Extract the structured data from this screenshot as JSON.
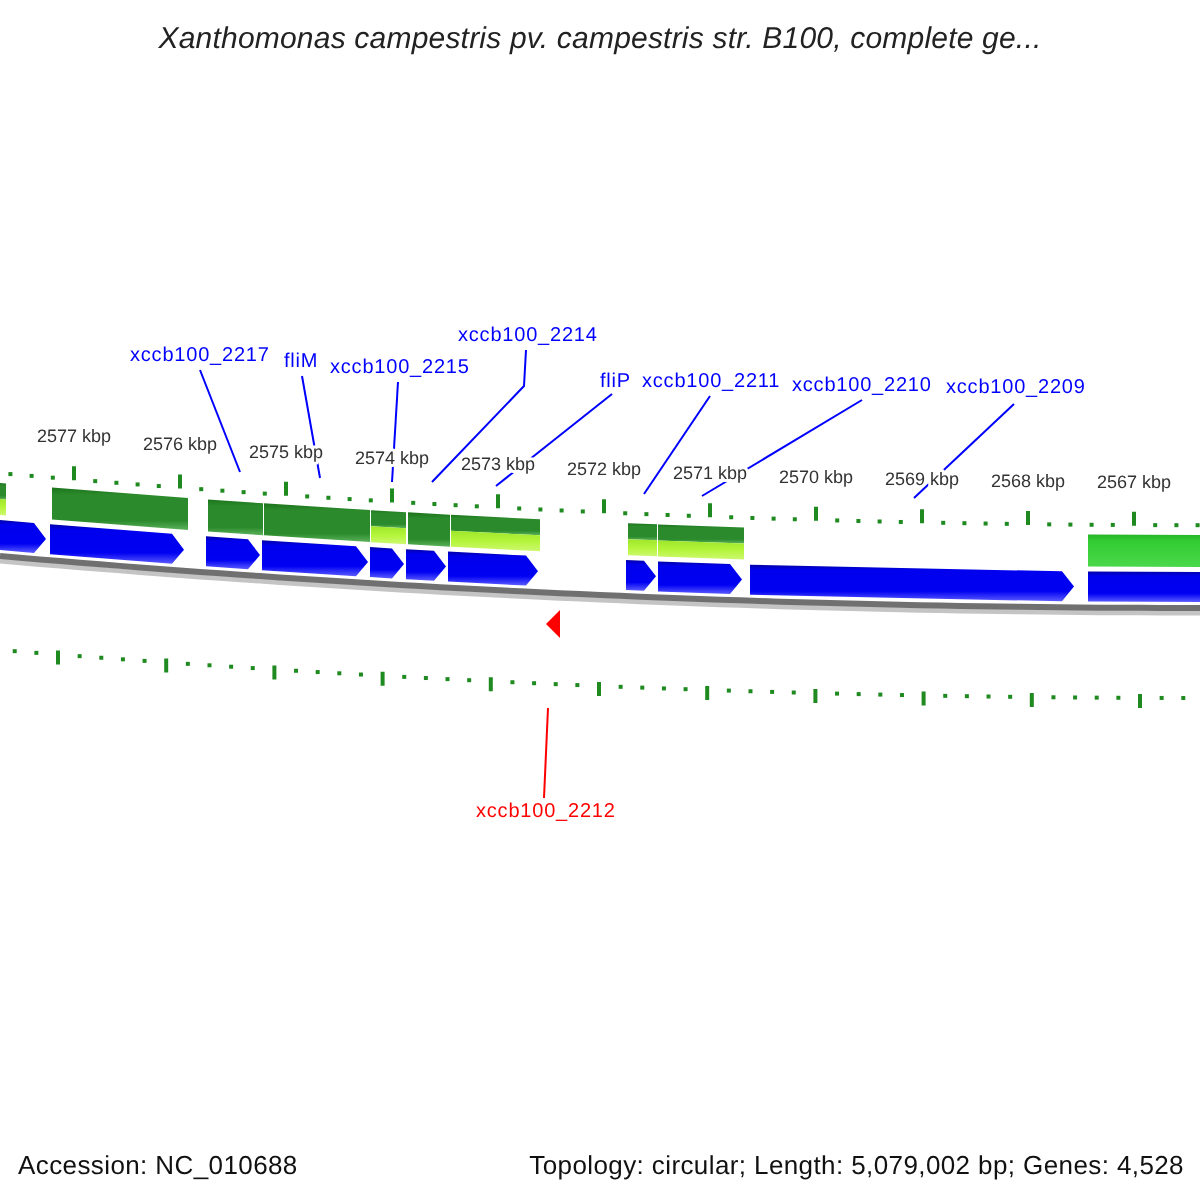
{
  "title": "Xanthomonas campestris pv. campestris str. B100, complete ge...",
  "map": {
    "ruler_labels": [
      "2577 kbp",
      "2576 kbp",
      "2575 kbp",
      "2574 kbp",
      "2573 kbp",
      "2572 kbp",
      "2571 kbp",
      "2570 kbp",
      "2569 kbp",
      "2568 kbp",
      "2567 kbp"
    ],
    "feature_blocks": [
      {
        "kind": "two-tone"
      },
      {
        "kind": "dark"
      },
      {
        "kind": "dark"
      },
      {
        "kind": "dark"
      },
      {
        "kind": "two-tone"
      },
      {
        "kind": "dark"
      },
      {
        "kind": "two-tone"
      },
      {
        "kind": "two-tone"
      },
      {
        "kind": "two-tone"
      },
      {
        "kind": "bright"
      }
    ],
    "gene_labels": [
      {
        "text": "xccb100_2217",
        "color": "#0000ff"
      },
      {
        "text": "fliM",
        "color": "#0000ff"
      },
      {
        "text": "xccb100_2215",
        "color": "#0000ff"
      },
      {
        "text": "xccb100_2214",
        "color": "#0000ff"
      },
      {
        "text": "fliP",
        "color": "#0000ff"
      },
      {
        "text": "xccb100_2211",
        "color": "#0000ff"
      },
      {
        "text": "xccb100_2210",
        "color": "#0000ff"
      },
      {
        "text": "xccb100_2209",
        "color": "#0000ff"
      },
      {
        "text": "xccb100_2212",
        "color": "#ff0000"
      }
    ]
  },
  "footer": {
    "accession": "Accession: NC_010688",
    "summary": "Topology: circular; Length: 5,079,002 bp; Genes: 4,528"
  }
}
